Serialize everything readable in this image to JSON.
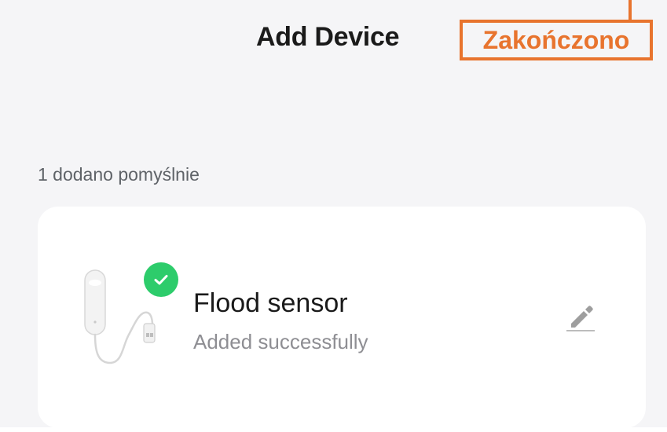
{
  "header": {
    "title": "Add Device",
    "done_label": "Zakończono",
    "accent_color": "#e8742e"
  },
  "section": {
    "label": "1 dodano pomyślnie"
  },
  "device": {
    "name": "Flood sensor",
    "status": "Added successfully",
    "image_icon": "flood-sensor-icon",
    "badge_icon": "check-icon",
    "badge_color": "#2dcc6b",
    "edit_icon": "pencil-icon"
  }
}
